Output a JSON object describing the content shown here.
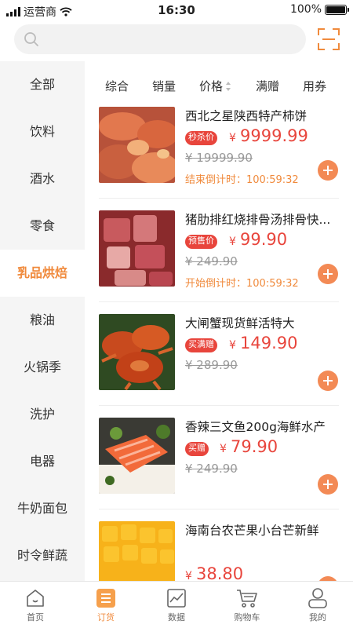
{
  "status_bar": {
    "carrier": "运营商",
    "time": "16:30",
    "battery": "100%",
    "battery_level": 1.0
  },
  "search": {
    "placeholder": ""
  },
  "sidebar": {
    "items": [
      {
        "label": "全部"
      },
      {
        "label": "饮料"
      },
      {
        "label": "酒水"
      },
      {
        "label": "零食"
      },
      {
        "label": "乳品烘焙"
      },
      {
        "label": "粮油"
      },
      {
        "label": "火锅季"
      },
      {
        "label": "洗护"
      },
      {
        "label": "电器"
      },
      {
        "label": "牛奶面包"
      },
      {
        "label": "时令鲜蔬"
      }
    ],
    "active_index": 4
  },
  "sort_bar": {
    "items": [
      {
        "label": "综合"
      },
      {
        "label": "销量"
      },
      {
        "label": "价格"
      },
      {
        "label": "满赠"
      },
      {
        "label": "用券"
      }
    ]
  },
  "products": [
    {
      "name": "西北之星陕西特产柿饼",
      "tag": "秒杀价",
      "currency": "¥",
      "price": "9999.99",
      "original_price": "¥ 19999.90",
      "countdown": "结束倒计时：100:59:32"
    },
    {
      "name": "猪肋排红烧排骨汤排骨快...",
      "tag": "预售价",
      "currency": "¥",
      "price": "99.90",
      "original_price": "¥ 249.90",
      "countdown": "开始倒计时：100:59:32"
    },
    {
      "name": "大闸蟹现货鲜活特大",
      "tag": "买满赠",
      "currency": "¥",
      "price": "149.90",
      "original_price": "¥ 289.90",
      "countdown": ""
    },
    {
      "name": "香辣三文鱼200g海鲜水产",
      "tag": "买赠",
      "currency": "¥",
      "price": "79.90",
      "original_price": "¥ 249.90",
      "countdown": ""
    },
    {
      "name": "海南台农芒果小台芒新鲜",
      "tag": "",
      "currency": "¥",
      "price": "38.80",
      "original_price": "",
      "countdown": ""
    }
  ],
  "tab_bar": {
    "items": [
      {
        "label": "首页",
        "icon": "home-icon"
      },
      {
        "label": "订货",
        "icon": "order-list-icon"
      },
      {
        "label": "数据",
        "icon": "chart-icon"
      },
      {
        "label": "购物车",
        "icon": "cart-icon"
      },
      {
        "label": "我的",
        "icon": "user-icon"
      }
    ],
    "active_index": 1
  },
  "colors": {
    "accent": "#f08a3c",
    "price": "#e8453c",
    "add_button": "#f38a55",
    "sidebar_bg": "#f5f5f5"
  }
}
